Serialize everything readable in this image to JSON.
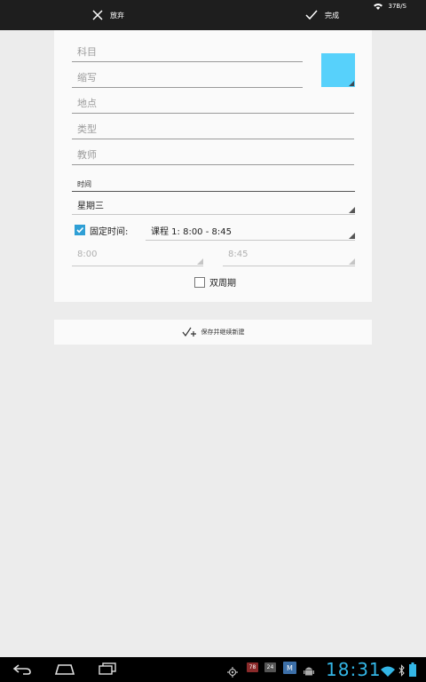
{
  "actionbar": {
    "discard_label": "放弃",
    "done_label": "完成",
    "net_speed": "37B/S"
  },
  "form": {
    "subject_placeholder": "科目",
    "abbr_placeholder": "缩写",
    "location_placeholder": "地点",
    "type_placeholder": "类型",
    "teacher_placeholder": "教师",
    "color_swatch": "#57d1fb"
  },
  "time": {
    "section_label": "时间",
    "weekday_value": "星期三",
    "fixed_time_label": "固定时间:",
    "fixed_time_checked": true,
    "period_value": "课程 1: 8:00 - 8:45",
    "start_time": "8:00",
    "end_time": "8:45",
    "biweekly_label": "双周期",
    "biweekly_checked": false
  },
  "savebar": {
    "label": "保存并继续新建"
  },
  "navbar": {
    "clock": "18:31",
    "badge1": "78",
    "badge2": "24",
    "icons": [
      "back-icon",
      "home-icon",
      "recent-apps-icon",
      "gps-icon",
      "notification-badge",
      "notification-badge",
      "app-icon",
      "android-icon",
      "wifi-icon",
      "bluetooth-icon",
      "battery-icon"
    ]
  },
  "colors": {
    "accent": "#33b5e5",
    "checkbox": "#2f9fd5",
    "actionbar": "#1e1e1e"
  }
}
